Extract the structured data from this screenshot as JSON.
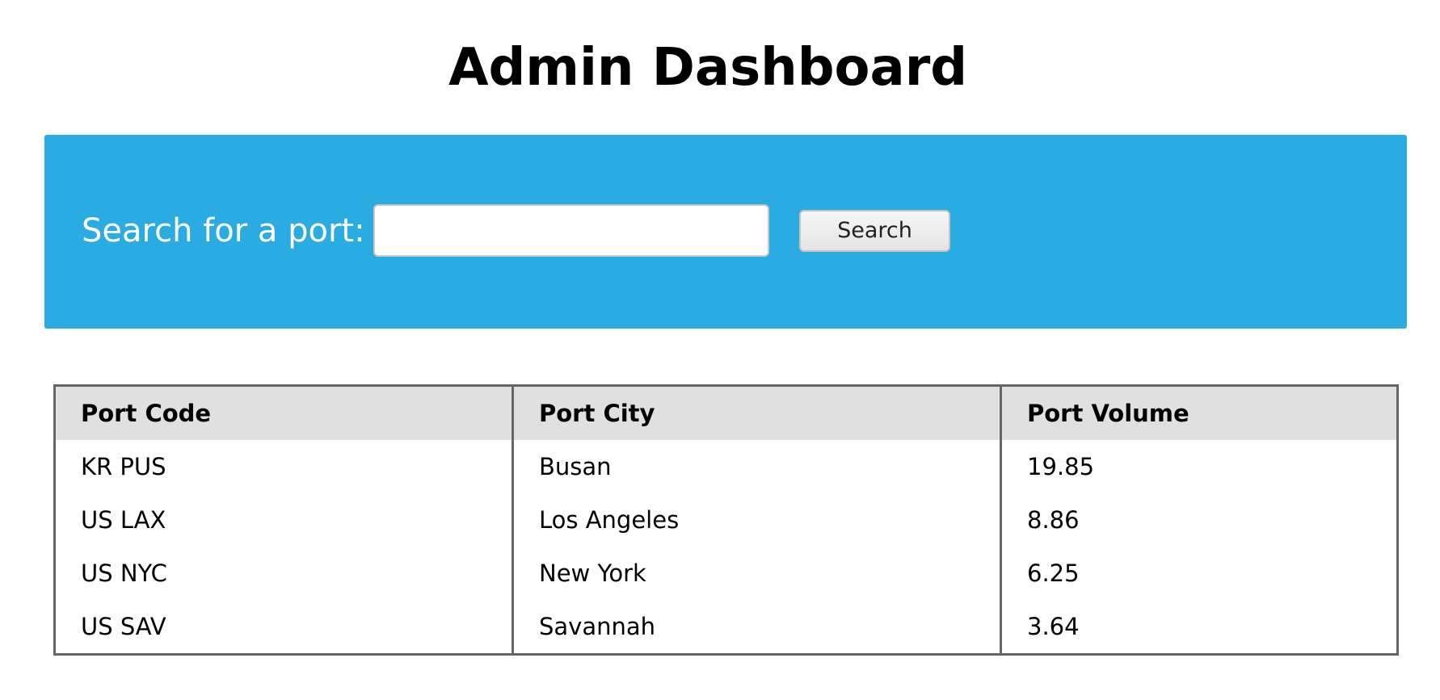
{
  "page": {
    "title": "Admin Dashboard"
  },
  "search": {
    "label": "Search for a port:",
    "value": "",
    "placeholder": "",
    "button_label": "Search"
  },
  "table": {
    "headers": [
      "Port Code",
      "Port City",
      "Port Volume"
    ],
    "rows": [
      [
        "KR PUS",
        "Busan",
        "19.85"
      ],
      [
        "US LAX",
        "Los Angeles",
        "8.86"
      ],
      [
        "US NYC",
        "New York",
        "6.25"
      ],
      [
        "US SAV",
        "Savannah",
        "3.64"
      ]
    ]
  },
  "colors": {
    "search_panel_bg": "#2aabe2",
    "table_header_bg": "#e0e0e0",
    "table_border": "#666666"
  }
}
